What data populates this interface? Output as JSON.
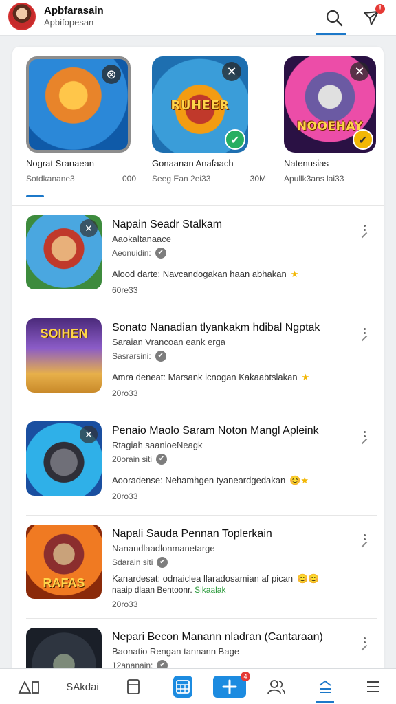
{
  "header": {
    "title": "Apbfarasain",
    "subtitle": "Apbifopesan",
    "notification_count": "!"
  },
  "featured": [
    {
      "name": "Nograt Sranaean",
      "meta_left": "Sotdkanane3",
      "meta_right": "000",
      "art_text": "",
      "badge": "close-icon"
    },
    {
      "name": "Gonaanan Anafaach",
      "meta_left": "Seeg Ean 2ei33",
      "meta_right": "30M",
      "art_text": "RUHEER",
      "badge": "check-icon"
    },
    {
      "name": "Natenusias",
      "meta_left": "Apullk3ans lai33",
      "meta_right": "",
      "art_text": "NOOEHAY",
      "badge": "check-icon",
      "extra": "⌐"
    }
  ],
  "apps": [
    {
      "title": "Napain Seadr Stalkam",
      "subtitle": "Aaokaltanaace",
      "verified": "Aeonuidin:",
      "description": "Alood darte: Navcandogakan haan abhakan",
      "desc_emoji": "★",
      "count": "60re33",
      "art_text": ""
    },
    {
      "title": "Sonato Nanadian tlyankakm hdibal Ngptak",
      "subtitle": "Saraian Vrancoan eank erga",
      "verified": "Sasrarsini:",
      "description": "Amra deneat: Marsank icnogan Kakaabtslakan",
      "desc_emoji": "★",
      "count": "20ro33",
      "art_text": "SOIHEN"
    },
    {
      "title": "Penaio Maolo Saram Noton Mangl Apleink",
      "subtitle": "Rtagiah saanioeNeagk",
      "verified": "20orain siti",
      "description": "Aooradense: Nehamhgen tyaneardgedakan",
      "desc_emoji": "😊★",
      "count": "20ro33",
      "art_text": ""
    },
    {
      "title": "Napali Sauda Pennan Toplerkain",
      "subtitle": "Nanandlaadlonmanetarge",
      "verified": "Sdarain siti",
      "description": "Kanardesat: odnaiclea llaradosamian af pican",
      "desc_emoji": "😊😊",
      "description_line2": "naaip dlaan Bentoonr.",
      "description_green": "Sikaalak",
      "count": "20ro33",
      "art_text": "RAFAS"
    },
    {
      "title": "Nepari Becon Manann nladran (Cantaraan)",
      "subtitle": "Baonatio Rengan tannann Bage",
      "verified": "12ananain:",
      "description": "",
      "desc_emoji": "",
      "count": "",
      "art_text": ""
    }
  ],
  "bottom_nav": {
    "item_text": "SAkdai",
    "badge": "4"
  },
  "colors": {
    "accent": "#1c78c9",
    "active_nav": "#1c8be0",
    "badge_red": "#e53935",
    "verified_green": "#27ae60",
    "star": "#f2b705"
  }
}
